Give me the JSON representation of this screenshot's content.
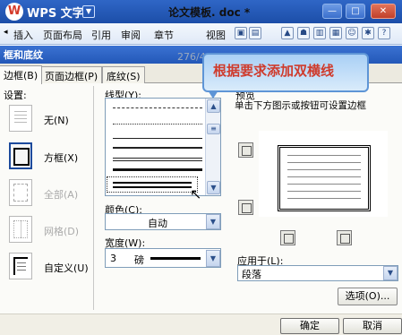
{
  "titlebar": {
    "app_name": "WPS 文字",
    "doc_title": "论文模板. doc *",
    "minimize": "—",
    "maximize": "□",
    "close": "✕"
  },
  "ribbon": {
    "menus": [
      "插入",
      "页面布局",
      "引用",
      "审阅",
      "章节",
      "视图"
    ]
  },
  "watermark": "276/4102",
  "dialog": {
    "title": "框和底纹",
    "tabs": [
      "边框(B)",
      "页面边框(P)",
      "底纹(S)"
    ],
    "setting_label": "设置:",
    "settings": [
      "无(N)",
      "方框(X)",
      "全部(A)",
      "网格(D)",
      "自定义(U)"
    ],
    "line_style_label": "线型(Y):",
    "color_label": "颜色(C):",
    "color_value": "自动",
    "width_label": "宽度(W):",
    "width_value": "3",
    "width_unit": "磅",
    "preview_label": "预览",
    "preview_hint": "单击下方图示或按钮可设置边框",
    "apply_label": "应用于(L):",
    "apply_value": "段落",
    "options_button": "选项(O)...",
    "ok_button": "确定",
    "cancel_button": "取消"
  },
  "callout": {
    "text": "根据要求添加双横线"
  }
}
